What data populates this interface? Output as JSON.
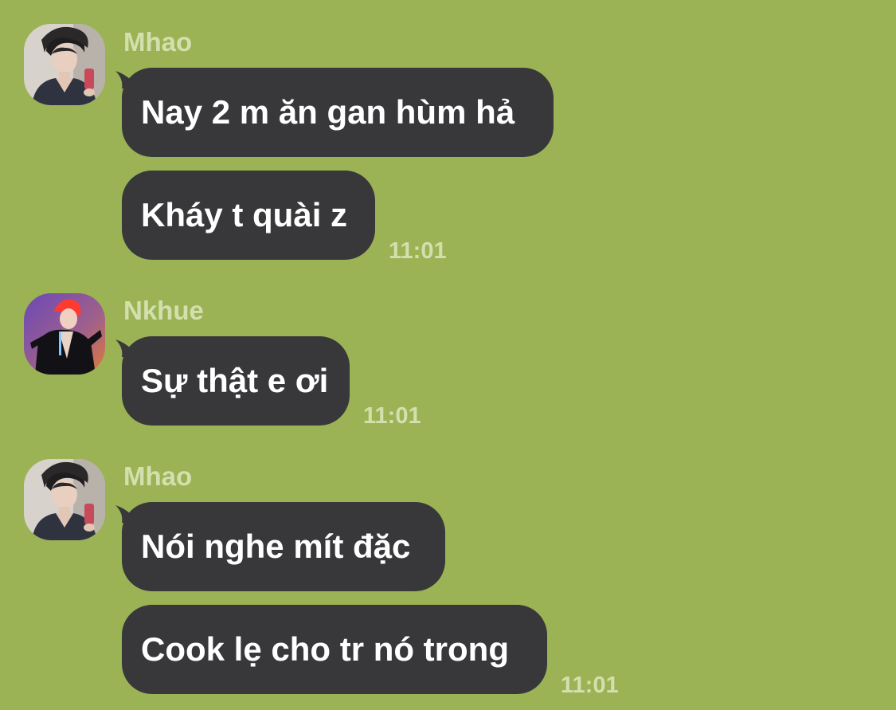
{
  "colors": {
    "background": "#9bb355",
    "bubble": "#38383a",
    "bubble_text": "#ffffff",
    "meta_text": "#d3e0ae"
  },
  "messages": [
    {
      "sender": "Mhao",
      "avatar": "mhao-avatar",
      "bubbles": [
        "Nay 2 m ăn gan hùm hả",
        "Kháy t quài z"
      ],
      "time": "11:01"
    },
    {
      "sender": "Nkhue",
      "avatar": "nkhue-avatar",
      "bubbles": [
        "Sự thật e ơi"
      ],
      "time": "11:01"
    },
    {
      "sender": "Mhao",
      "avatar": "mhao-avatar",
      "bubbles": [
        "Nói nghe mít đặc",
        "Cook lẹ cho tr nó trong"
      ],
      "time": "11:01"
    }
  ]
}
